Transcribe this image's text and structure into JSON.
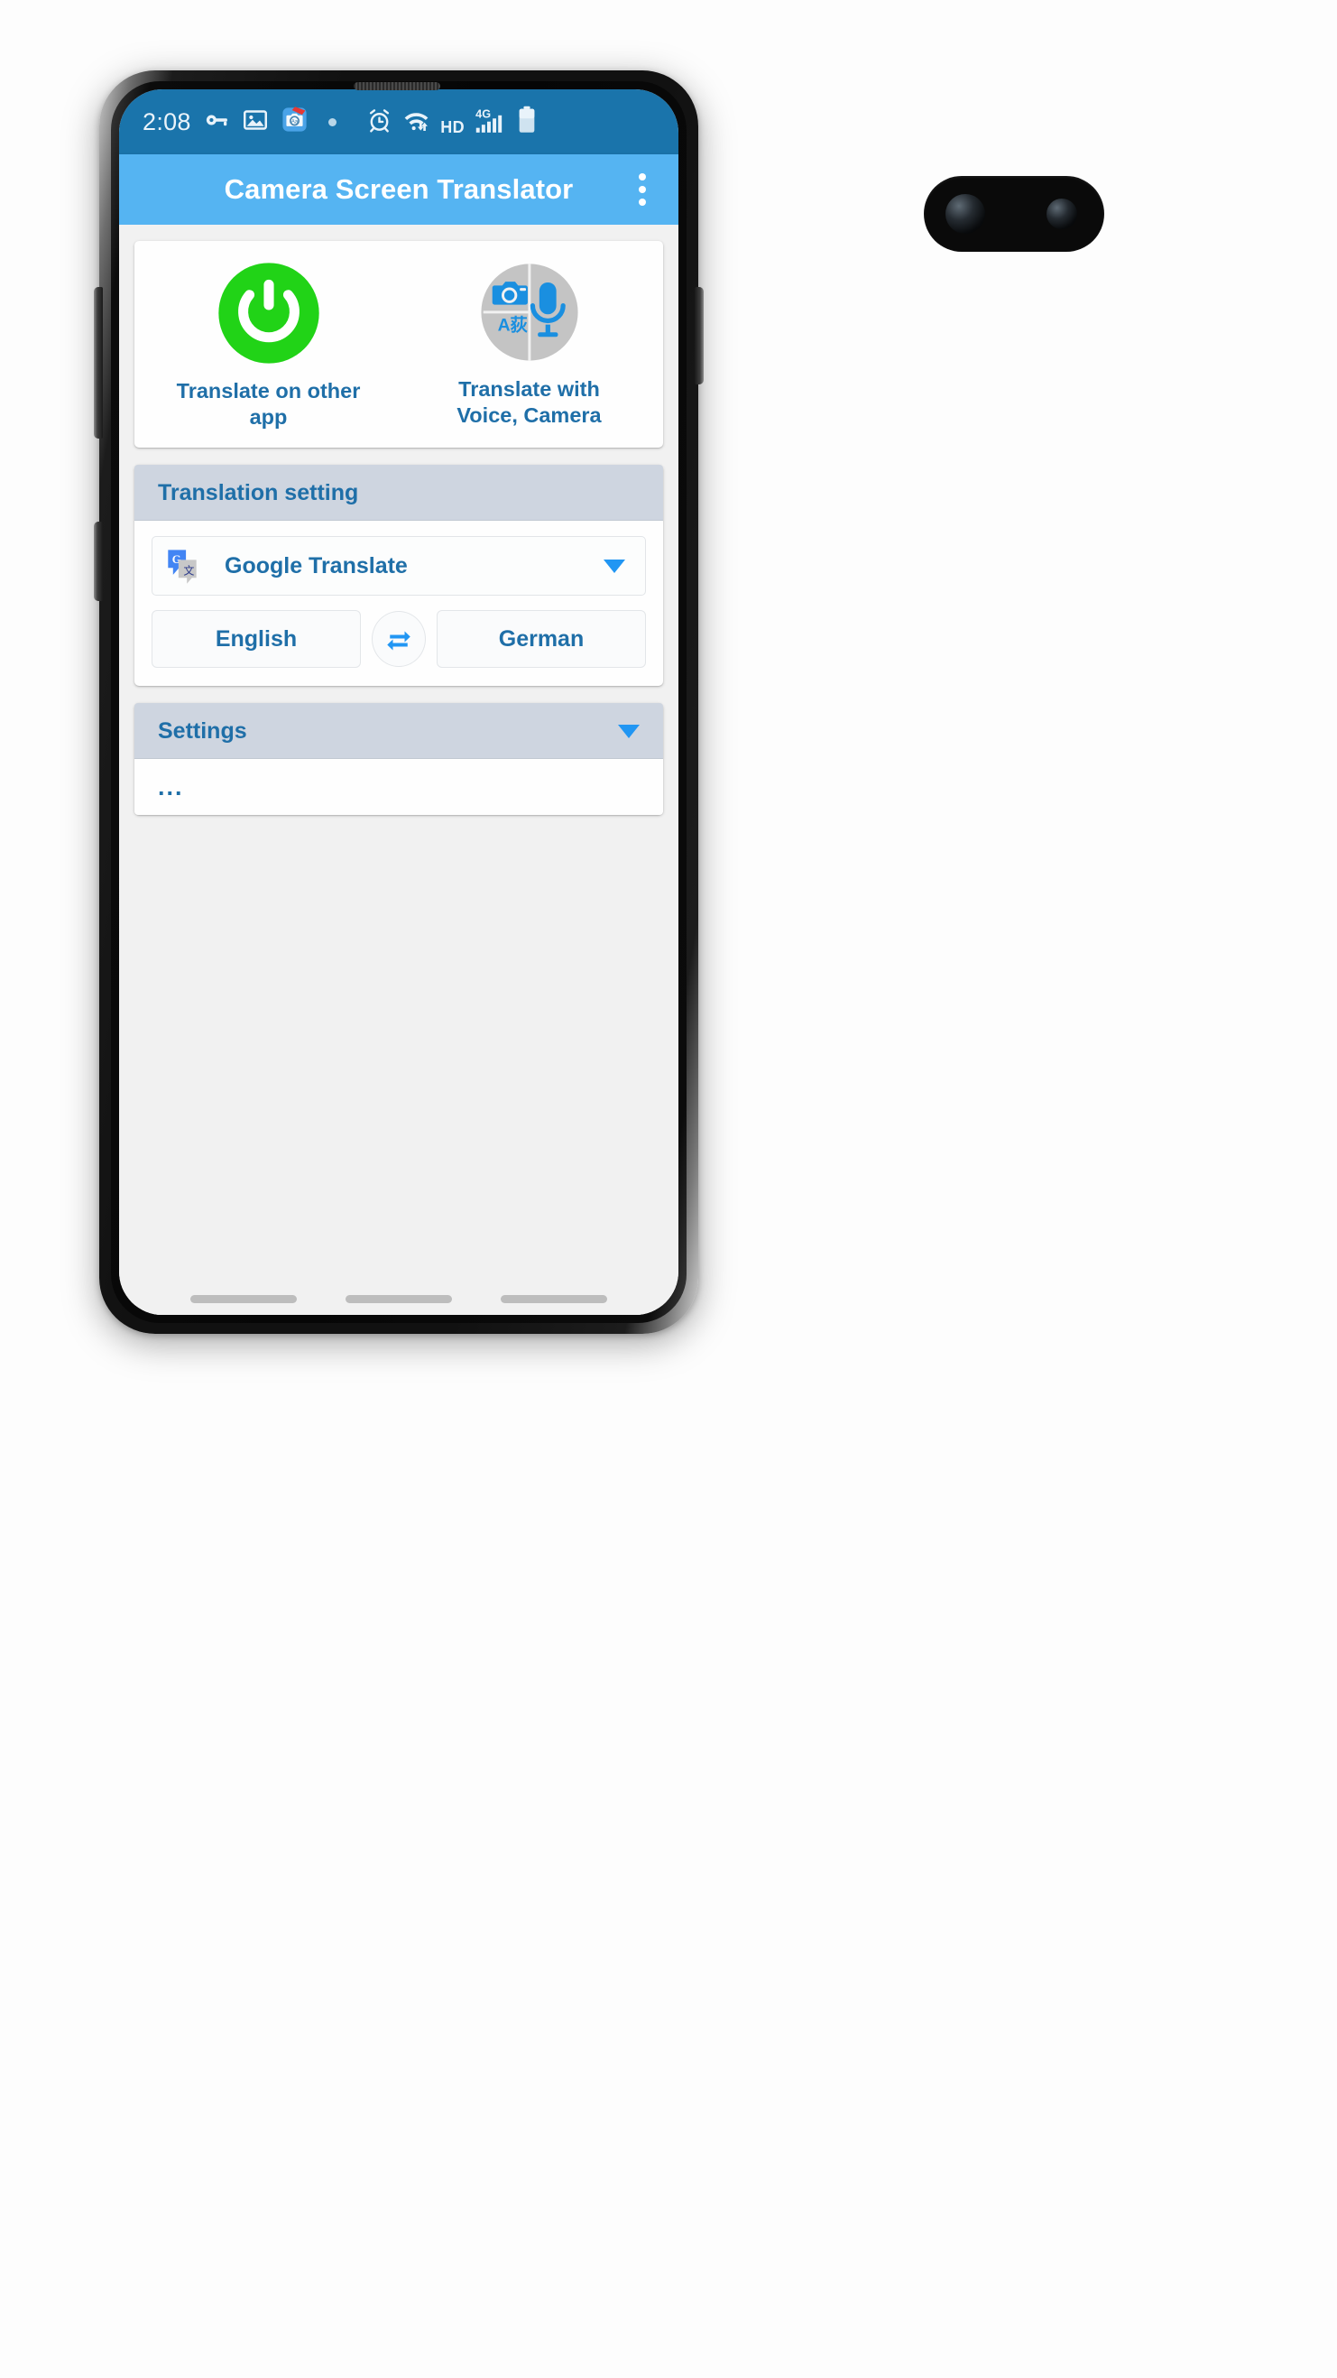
{
  "status_bar": {
    "time": "2:08",
    "left_icons": [
      "key-icon",
      "image-icon",
      "screenshot-camera-icon"
    ],
    "dot": "notification-dot",
    "right_icons": [
      "alarm-icon",
      "wifi-icon",
      "hd-icon",
      "signal-4g-icon",
      "battery-icon"
    ],
    "hd_label": "HD",
    "network_label": "4G",
    "bg_color": "#1a74ab"
  },
  "app_bar": {
    "title": "Camera Screen Translator",
    "overflow_icon": "more-vertical-icon",
    "bg_color": "#55b4f2"
  },
  "shortcuts": [
    {
      "icon": "power-icon",
      "label": "Translate on other app",
      "color": "#21d317"
    },
    {
      "icon": "voice-camera-icon",
      "label": "Translate with Voice, Camera",
      "color": "#c4c4c4"
    }
  ],
  "translation_setting": {
    "header": "Translation setting",
    "engine": {
      "icon": "google-translate-icon",
      "name": "Google Translate",
      "caret": "chevron-down-icon"
    },
    "source_language": "English",
    "target_language": "German",
    "swap_icon": "swap-horizontal-icon"
  },
  "settings": {
    "header": "Settings",
    "caret": "chevron-down-icon",
    "body_text": "..."
  },
  "floating": {
    "target_icon": "bullseye-target-icon"
  },
  "nav_bar": {
    "items": [
      "recents-pill",
      "home-pill",
      "back-pill"
    ]
  },
  "theme": {
    "accent_blue": "#2196f3",
    "text_blue": "#1f6fa8",
    "section_header_bg": "#ced5e0",
    "page_bg": "#f1f1f1"
  }
}
